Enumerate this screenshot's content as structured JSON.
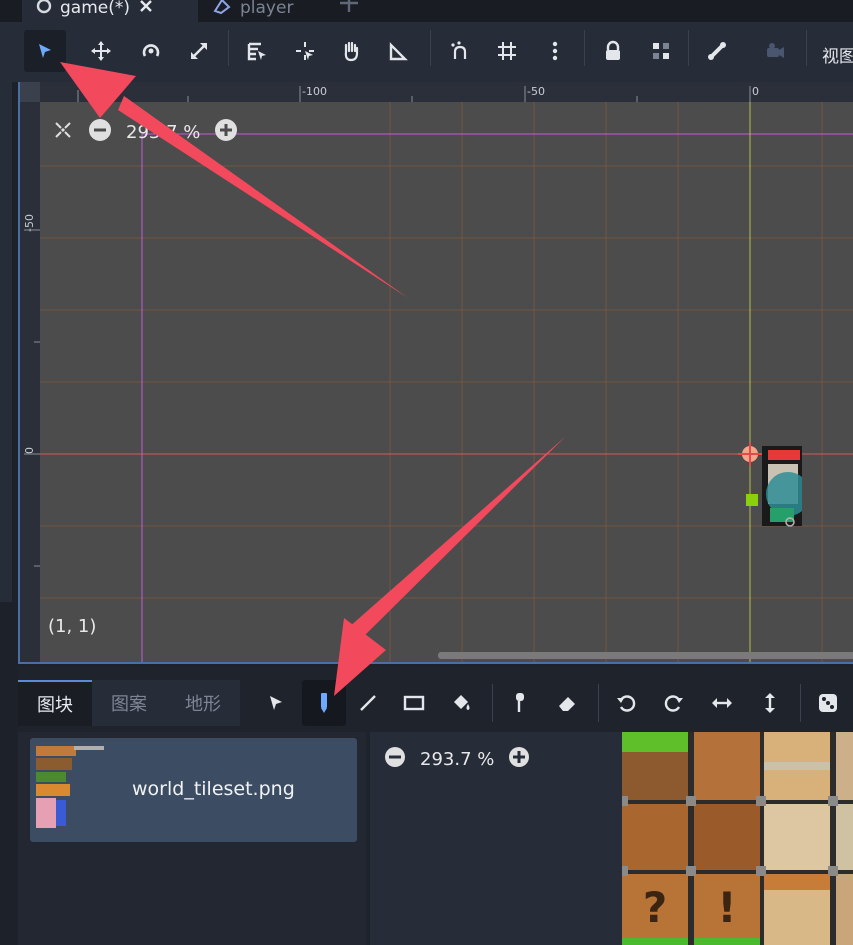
{
  "tabs": [
    {
      "label": "game(*)",
      "active": true
    },
    {
      "label": "player",
      "active": false
    }
  ],
  "toolbar": {
    "tools": [
      "select-icon",
      "move-icon",
      "rotate-icon",
      "scale-icon",
      "list-select-icon",
      "pivot-icon",
      "pan-icon",
      "ruler-icon",
      "snap-icon",
      "grid-icon",
      "more-icon",
      "lock-icon",
      "group-icon",
      "bone-icon",
      "camera-icon"
    ],
    "view_label": "视图"
  },
  "viewport": {
    "ruler_top_labels": [
      "-100",
      "-50",
      "0"
    ],
    "ruler_left_labels": [
      "-50",
      "0"
    ],
    "zoom_text": "293.7 %",
    "coord_text": "(1, 1)"
  },
  "bottom_panel": {
    "tabs": [
      "图块",
      "图案",
      "地形"
    ],
    "tiles_file": "world_tileset.png",
    "zoom_text": "293.7 %"
  },
  "colors": {
    "accent": "#4a6fa5",
    "annotation_arrow": "#f2495d",
    "viewport_bg": "#4c4c4c"
  }
}
